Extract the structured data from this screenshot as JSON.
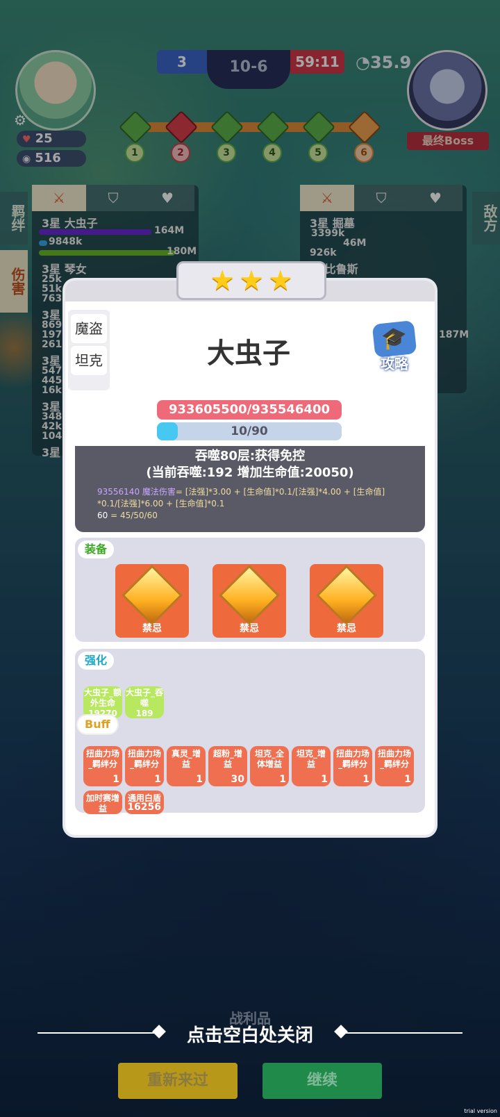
{
  "hud": {
    "hp": "25",
    "coins": "516",
    "left_score": "3",
    "stage": "10-6",
    "right_score": "59:11",
    "timer": "35.9",
    "boss_label": "最终Boss",
    "stages": [
      "1",
      "2",
      "3",
      "4",
      "5",
      "6"
    ]
  },
  "side": {
    "bond_tab": "羁绊",
    "damage_tab": "伤害",
    "enemy_tab": "敌方"
  },
  "background_panel": {
    "left_rows": [
      "3星 大虫子",
      "3星 琴女",
      "3星",
      "3星",
      "3星",
      "3星"
    ],
    "left_values": [
      "164M",
      "9848k",
      "180M"
    ],
    "left_stats": [
      "25k",
      "51k",
      "7631",
      "8699",
      "197k",
      "2610",
      "5478",
      "445k",
      "16k",
      "3488",
      "42k",
      "1046"
    ],
    "right_rows": [
      "3星 掘墓",
      "星 比鲁斯"
    ],
    "right_values": [
      "3399k",
      "46M",
      "926k",
      "187M"
    ]
  },
  "modal": {
    "stars": 3,
    "class_tabs": [
      "魔盗",
      "坦克"
    ],
    "hero_name": "大虫子",
    "guide_label": "攻略",
    "hp_text": "933605500/935546400",
    "exp_text": "10/90",
    "exp_progress": 0.111,
    "info_line1": "吞噬80层:获得免控",
    "info_line2": "(当前吞噬:192 增加生命值:20050)",
    "formula_value": "93556140 魔法伤害",
    "formula_expr": "= [法强]*3.00 + [生命值]*0.1/[法强]*4.00 + [生命值]",
    "formula_line2": "*0.1/[法强]*6.00 + [生命值]*0.1",
    "formula_line3_head": "60",
    "formula_line3_tail": " = 45/50/60",
    "equip_label": "装备",
    "equipment": [
      "禁忌",
      "禁忌",
      "禁忌"
    ],
    "enhance_label": "强化",
    "enhancements": [
      {
        "text": "大虫子_额外生命",
        "value": "19270"
      },
      {
        "text": "大虫子_吞噬",
        "value": "189"
      }
    ],
    "buff_label": "Buff",
    "buffs": [
      {
        "text": "扭曲力场_羁绊分",
        "value": "1"
      },
      {
        "text": "扭曲力场_羁绊分",
        "value": "1"
      },
      {
        "text": "真灵_增益",
        "value": "1"
      },
      {
        "text": "超粉_增益",
        "value": "30"
      },
      {
        "text": "坦克_全体增益",
        "value": "1"
      },
      {
        "text": "坦克_增益",
        "value": "1"
      },
      {
        "text": "扭曲力场_羁绊分",
        "value": "1"
      },
      {
        "text": "扭曲力场_羁绊分",
        "value": "1"
      },
      {
        "text": "加时赛增益",
        "value": ""
      },
      {
        "text": "通用白盾",
        "value": "16256"
      }
    ]
  },
  "bottom": {
    "loot_ghost": "战利品",
    "close_hint": "点击空白处关闭",
    "retry_button": "重新来过",
    "continue_button": "继续",
    "trial": "trial version"
  },
  "colors": {
    "accent_red": "#ee6a78",
    "exp_blue": "#46c8f0",
    "equip_orange": "#ee6a3c",
    "buff_orange": "#ee7050",
    "enhance_green": "#b8e860",
    "star_gold": "#ffcc1a"
  }
}
